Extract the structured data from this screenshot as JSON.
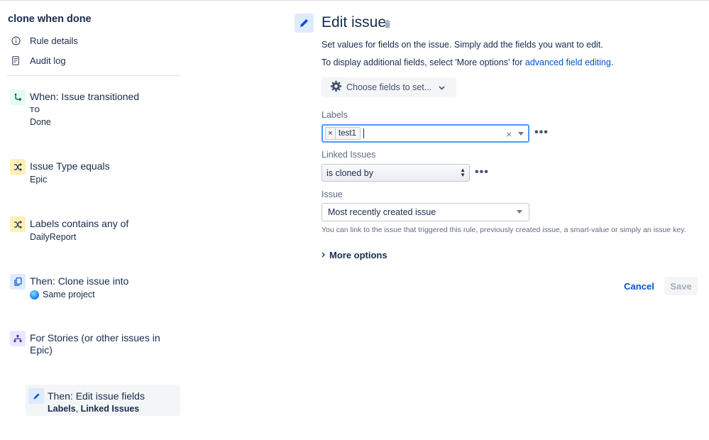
{
  "sidebar": {
    "rule_title": "clone when done",
    "nav": [
      {
        "label": "Rule details",
        "icon": "info-icon"
      },
      {
        "label": "Audit log",
        "icon": "document-icon"
      }
    ],
    "steps": [
      {
        "title": "When: Issue transitioned",
        "caption": "TO",
        "sub": "Done",
        "icon": "transition-icon",
        "color": "#e3fcef"
      },
      {
        "title": "Issue Type equals",
        "sub": "Epic",
        "icon": "condition-icon",
        "color": "#fff0b3"
      },
      {
        "title": "Labels contains any of",
        "sub": "DailyReport",
        "icon": "condition-icon",
        "color": "#fff0b3"
      },
      {
        "title": "Then: Clone issue into",
        "sub": "Same project",
        "icon": "clone-icon",
        "color": "#deebff"
      },
      {
        "title": "For Stories (or other issues in Epic)",
        "icon": "branch-icon",
        "color": "#eae6ff"
      }
    ],
    "selected_step": {
      "title": "Then: Edit issue fields",
      "sub_part1": "Labels",
      "sub_sep": ", ",
      "sub_part2": "Linked Issues",
      "icon": "pencil-icon"
    }
  },
  "editor": {
    "title": "Edit issue",
    "desc1": "Set values for fields on the issue. Simply add the fields you want to edit.",
    "desc2_prefix": "To display additional fields, select 'More options' for ",
    "desc2_link": "advanced field editing",
    "desc2_suffix": ".",
    "choose_fields_label": "Choose fields to set...",
    "labels_field": {
      "label": "Labels",
      "tags": [
        "test1"
      ],
      "remove_glyph": "×",
      "clear_glyph": "×"
    },
    "linked_issues_field": {
      "label": "Linked Issues",
      "selected": "is cloned by"
    },
    "issue_field": {
      "label": "Issue",
      "selected": "Most recently created issue",
      "help": "You can link to the issue that triggered this rule, previously created issue, a smart-value or simply an issue key."
    },
    "more_options_label": "More options",
    "more_glyph": "•••",
    "cancel_label": "Cancel",
    "save_label": "Save"
  },
  "colors": {
    "primary": "#0052cc",
    "focus_border": "#4c9aff",
    "text": "#172b4d",
    "muted": "#5e6c84"
  }
}
